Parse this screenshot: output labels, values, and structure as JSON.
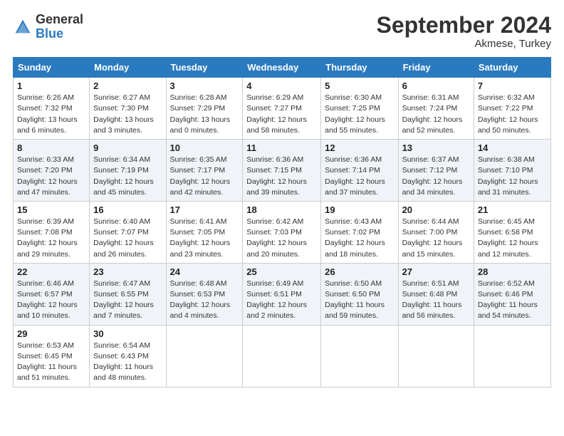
{
  "header": {
    "logo_general": "General",
    "logo_blue": "Blue",
    "month_title": "September 2024",
    "location": "Akmese, Turkey"
  },
  "days_of_week": [
    "Sunday",
    "Monday",
    "Tuesday",
    "Wednesday",
    "Thursday",
    "Friday",
    "Saturday"
  ],
  "weeks": [
    [
      {
        "day": "1",
        "sunrise": "Sunrise: 6:26 AM",
        "sunset": "Sunset: 7:32 PM",
        "daylight": "Daylight: 13 hours and 6 minutes."
      },
      {
        "day": "2",
        "sunrise": "Sunrise: 6:27 AM",
        "sunset": "Sunset: 7:30 PM",
        "daylight": "Daylight: 13 hours and 3 minutes."
      },
      {
        "day": "3",
        "sunrise": "Sunrise: 6:28 AM",
        "sunset": "Sunset: 7:29 PM",
        "daylight": "Daylight: 13 hours and 0 minutes."
      },
      {
        "day": "4",
        "sunrise": "Sunrise: 6:29 AM",
        "sunset": "Sunset: 7:27 PM",
        "daylight": "Daylight: 12 hours and 58 minutes."
      },
      {
        "day": "5",
        "sunrise": "Sunrise: 6:30 AM",
        "sunset": "Sunset: 7:25 PM",
        "daylight": "Daylight: 12 hours and 55 minutes."
      },
      {
        "day": "6",
        "sunrise": "Sunrise: 6:31 AM",
        "sunset": "Sunset: 7:24 PM",
        "daylight": "Daylight: 12 hours and 52 minutes."
      },
      {
        "day": "7",
        "sunrise": "Sunrise: 6:32 AM",
        "sunset": "Sunset: 7:22 PM",
        "daylight": "Daylight: 12 hours and 50 minutes."
      }
    ],
    [
      {
        "day": "8",
        "sunrise": "Sunrise: 6:33 AM",
        "sunset": "Sunset: 7:20 PM",
        "daylight": "Daylight: 12 hours and 47 minutes."
      },
      {
        "day": "9",
        "sunrise": "Sunrise: 6:34 AM",
        "sunset": "Sunset: 7:19 PM",
        "daylight": "Daylight: 12 hours and 45 minutes."
      },
      {
        "day": "10",
        "sunrise": "Sunrise: 6:35 AM",
        "sunset": "Sunset: 7:17 PM",
        "daylight": "Daylight: 12 hours and 42 minutes."
      },
      {
        "day": "11",
        "sunrise": "Sunrise: 6:36 AM",
        "sunset": "Sunset: 7:15 PM",
        "daylight": "Daylight: 12 hours and 39 minutes."
      },
      {
        "day": "12",
        "sunrise": "Sunrise: 6:36 AM",
        "sunset": "Sunset: 7:14 PM",
        "daylight": "Daylight: 12 hours and 37 minutes."
      },
      {
        "day": "13",
        "sunrise": "Sunrise: 6:37 AM",
        "sunset": "Sunset: 7:12 PM",
        "daylight": "Daylight: 12 hours and 34 minutes."
      },
      {
        "day": "14",
        "sunrise": "Sunrise: 6:38 AM",
        "sunset": "Sunset: 7:10 PM",
        "daylight": "Daylight: 12 hours and 31 minutes."
      }
    ],
    [
      {
        "day": "15",
        "sunrise": "Sunrise: 6:39 AM",
        "sunset": "Sunset: 7:08 PM",
        "daylight": "Daylight: 12 hours and 29 minutes."
      },
      {
        "day": "16",
        "sunrise": "Sunrise: 6:40 AM",
        "sunset": "Sunset: 7:07 PM",
        "daylight": "Daylight: 12 hours and 26 minutes."
      },
      {
        "day": "17",
        "sunrise": "Sunrise: 6:41 AM",
        "sunset": "Sunset: 7:05 PM",
        "daylight": "Daylight: 12 hours and 23 minutes."
      },
      {
        "day": "18",
        "sunrise": "Sunrise: 6:42 AM",
        "sunset": "Sunset: 7:03 PM",
        "daylight": "Daylight: 12 hours and 20 minutes."
      },
      {
        "day": "19",
        "sunrise": "Sunrise: 6:43 AM",
        "sunset": "Sunset: 7:02 PM",
        "daylight": "Daylight: 12 hours and 18 minutes."
      },
      {
        "day": "20",
        "sunrise": "Sunrise: 6:44 AM",
        "sunset": "Sunset: 7:00 PM",
        "daylight": "Daylight: 12 hours and 15 minutes."
      },
      {
        "day": "21",
        "sunrise": "Sunrise: 6:45 AM",
        "sunset": "Sunset: 6:58 PM",
        "daylight": "Daylight: 12 hours and 12 minutes."
      }
    ],
    [
      {
        "day": "22",
        "sunrise": "Sunrise: 6:46 AM",
        "sunset": "Sunset: 6:57 PM",
        "daylight": "Daylight: 12 hours and 10 minutes."
      },
      {
        "day": "23",
        "sunrise": "Sunrise: 6:47 AM",
        "sunset": "Sunset: 6:55 PM",
        "daylight": "Daylight: 12 hours and 7 minutes."
      },
      {
        "day": "24",
        "sunrise": "Sunrise: 6:48 AM",
        "sunset": "Sunset: 6:53 PM",
        "daylight": "Daylight: 12 hours and 4 minutes."
      },
      {
        "day": "25",
        "sunrise": "Sunrise: 6:49 AM",
        "sunset": "Sunset: 6:51 PM",
        "daylight": "Daylight: 12 hours and 2 minutes."
      },
      {
        "day": "26",
        "sunrise": "Sunrise: 6:50 AM",
        "sunset": "Sunset: 6:50 PM",
        "daylight": "Daylight: 11 hours and 59 minutes."
      },
      {
        "day": "27",
        "sunrise": "Sunrise: 6:51 AM",
        "sunset": "Sunset: 6:48 PM",
        "daylight": "Daylight: 11 hours and 56 minutes."
      },
      {
        "day": "28",
        "sunrise": "Sunrise: 6:52 AM",
        "sunset": "Sunset: 6:46 PM",
        "daylight": "Daylight: 11 hours and 54 minutes."
      }
    ],
    [
      {
        "day": "29",
        "sunrise": "Sunrise: 6:53 AM",
        "sunset": "Sunset: 6:45 PM",
        "daylight": "Daylight: 11 hours and 51 minutes."
      },
      {
        "day": "30",
        "sunrise": "Sunrise: 6:54 AM",
        "sunset": "Sunset: 6:43 PM",
        "daylight": "Daylight: 11 hours and 48 minutes."
      },
      null,
      null,
      null,
      null,
      null
    ]
  ]
}
